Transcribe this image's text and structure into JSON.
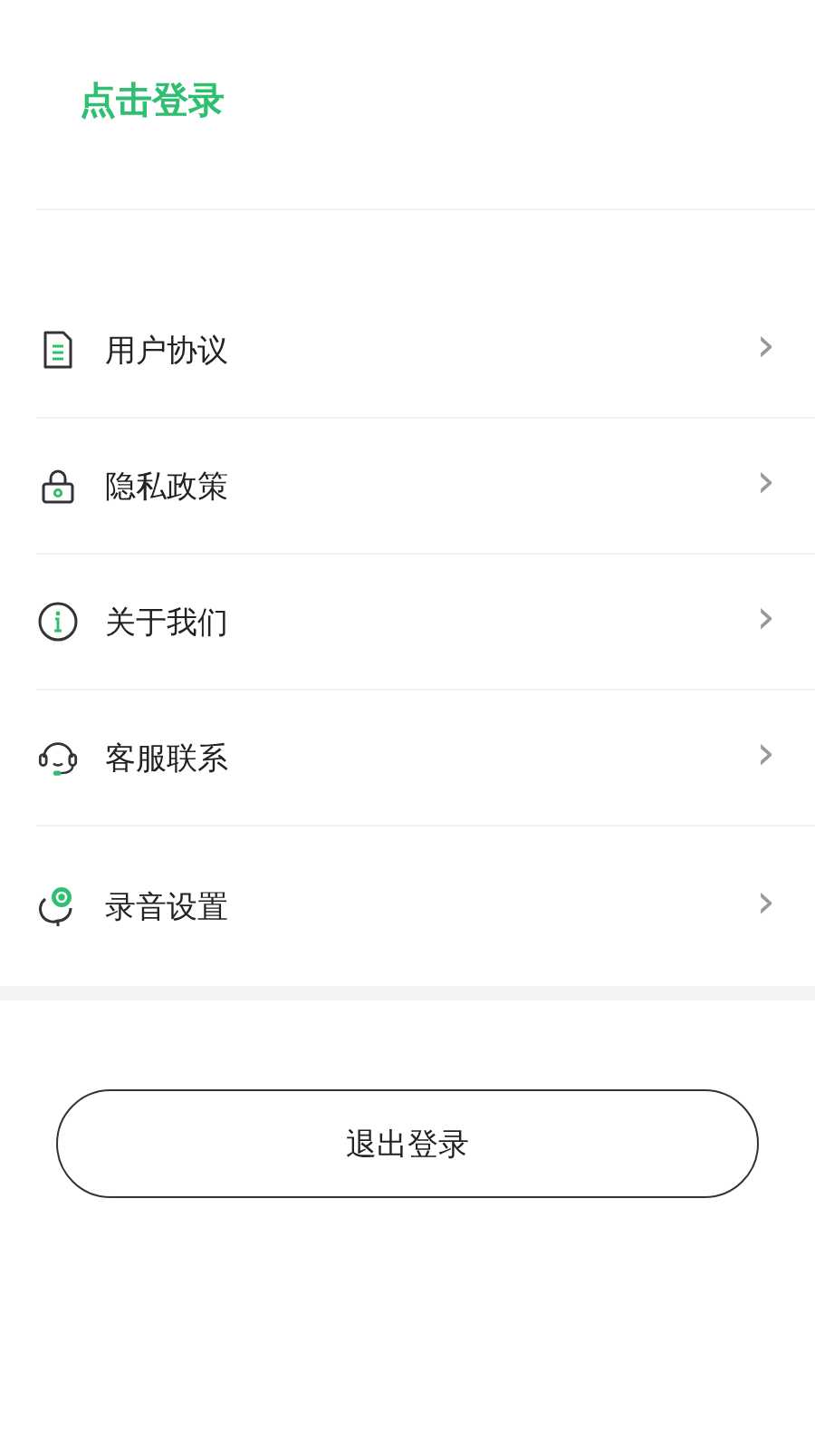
{
  "login": {
    "label": "点击登录"
  },
  "menu_groups": [
    [
      {
        "label": "用户协议",
        "chevron": "›"
      },
      {
        "label": "隐私政策",
        "chevron": "›"
      },
      {
        "label": "关于我们",
        "chevron": "›"
      },
      {
        "label": "客服联系",
        "chevron": "›"
      }
    ],
    [
      {
        "label": "录音设置",
        "chevron": "›"
      }
    ]
  ],
  "logout_button": {
    "label": "退出登录"
  }
}
